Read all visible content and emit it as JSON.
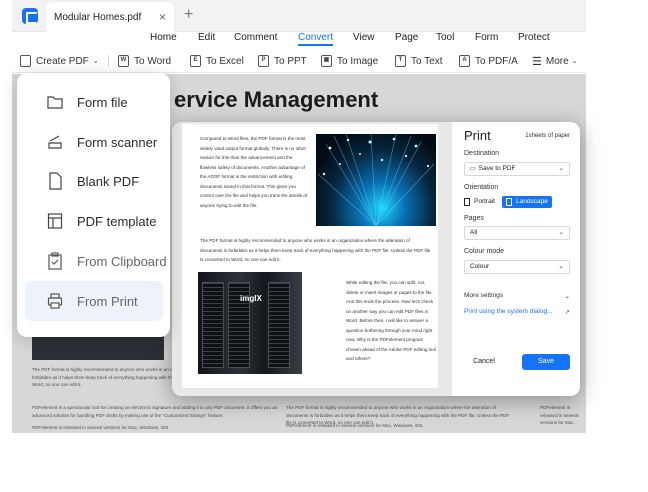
{
  "window": {
    "tab_title": "Modular Homes.pdf",
    "close_glyph": "×",
    "new_tab_glyph": "+"
  },
  "menu": [
    "Home",
    "Edit",
    "Comment",
    "Convert",
    "View",
    "Page",
    "Tool",
    "Form",
    "Protect"
  ],
  "menu_active": "Convert",
  "toolbar": {
    "create_pdf": "Create PDF",
    "to_word": "To Word",
    "to_excel": "To Excel",
    "to_ppt": "To PPT",
    "to_image": "To Image",
    "to_text": "To Text",
    "to_pdfa": "To PDF/A",
    "more": "More"
  },
  "dropdown": {
    "items": [
      {
        "label": "Form file",
        "icon": "folder-icon"
      },
      {
        "label": "Form scanner",
        "icon": "scanner-icon"
      },
      {
        "label": "Blank PDF",
        "icon": "blank-page-icon"
      },
      {
        "label": "PDF template",
        "icon": "template-icon"
      },
      {
        "label": "From Clipboard",
        "icon": "clipboard-icon"
      },
      {
        "label": "From Print",
        "icon": "printer-icon"
      }
    ],
    "selected_index": 5
  },
  "document": {
    "title_visible": "ervice Management",
    "para_left_1": "The PDF format is highly recommended to anyone who works in an organization where the alteration of documents is forbidden as it helps them keep track of everything happening with the PDF file. Unless the PDF file is converted to Word, no one can edit it.",
    "para_left_2": "PDFelement is a spectacular tool for creating an electronic signature and adding it to any PDF document. It offers you an advanced solution for handling PDF drafts by making use of the \"Customized Stamps\" feature.",
    "para_left_3": "PDFelement is released in several versions for Mac, Windows, iOS.",
    "para_mid_1": "The PDF format is highly recommended to anyone who works in an organization where the alteration of documents is forbidden as it helps them keep track of everything happening with the PDF file. Unless the PDF file is converted to Word, no one can edit it.",
    "para_mid_2": "PDFelement is released in several versions for Mac, Windows, iOS.",
    "para_right": "PDFelement is released in several versions for Mac, Windows, iOS."
  },
  "preview": {
    "col1": "Compared to Word files, the PDF format is the most widely used output format globally. There is no other reason for this than the advancement and the flawless safety of documents. Another advantage of the ADOF format is the restriction with editing documents saved in that format. This gives you control over the file and helps you track the details of anyone trying to edit the file.",
    "full": "The PDF format is highly recommended to anyone who works in an organization where the alteration of documents is forbidden as it helps them keep track of everything happening with the PDF file. Unless the PDF file is converted to Word, no one can edit it.",
    "col2": "While editing the file, you can split, cut, delete or insert images or pages to the file. And this ends the process. Now let's check on another way you can edit PDF files in Word. Before then, I will like to answer a question bothering through your mind right now. Why is the PDFelement program chosen ahead of the Adobe PDF editing tool and others?",
    "img_watermark": "imgIX"
  },
  "print": {
    "title": "Print",
    "sheets": "1sheets of paper",
    "destination_label": "Destination",
    "destination_value": "Save to PDF",
    "orientation_label": "Orientation",
    "portrait": "Portrait",
    "landscape": "Landscape",
    "orientation_selected": "Landscape",
    "pages_label": "Pages",
    "pages_value": "All",
    "colour_label": "Colour mode",
    "colour_value": "Colour",
    "more_settings": "More settings",
    "system_dialog": "Print using the system dialog...",
    "cancel": "Cancel",
    "save": "Save"
  },
  "colors": {
    "accent": "#1773f5",
    "dim_background": "#d7d7d8"
  }
}
